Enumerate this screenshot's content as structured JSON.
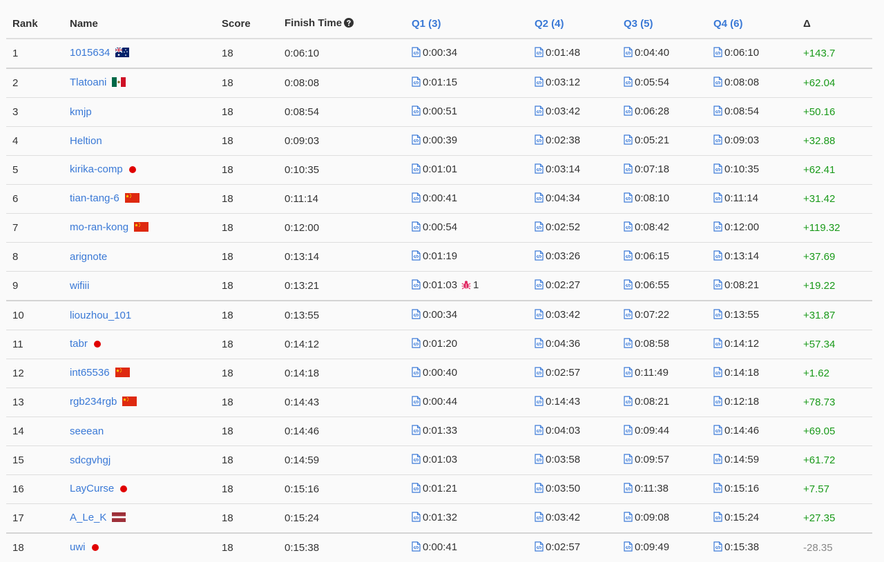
{
  "header": {
    "rank": "Rank",
    "name": "Name",
    "score": "Score",
    "finish_time": "Finish Time",
    "q1": "Q1 (3)",
    "q2": "Q2 (4)",
    "q3": "Q3 (5)",
    "q4": "Q4 (6)",
    "delta": "Δ"
  },
  "colors": {
    "link": "#3a79d6",
    "positive": "#1a9a1a",
    "negative": "#888888",
    "bug": "#e0245e"
  },
  "rows": [
    {
      "rank": "1",
      "name": "1015634",
      "flag": "au",
      "score": "18",
      "finish": "0:06:10",
      "q1": "0:00:34",
      "q2": "0:01:48",
      "q3": "0:04:40",
      "q4": "0:06:10",
      "delta": "+143.7"
    },
    {
      "rank": "2",
      "name": "Tlatoani",
      "flag": "mx",
      "score": "18",
      "finish": "0:08:08",
      "q1": "0:01:15",
      "q2": "0:03:12",
      "q3": "0:05:54",
      "q4": "0:08:08",
      "delta": "+62.04"
    },
    {
      "rank": "3",
      "name": "kmjp",
      "flag": "",
      "score": "18",
      "finish": "0:08:54",
      "q1": "0:00:51",
      "q2": "0:03:42",
      "q3": "0:06:28",
      "q4": "0:08:54",
      "delta": "+50.16"
    },
    {
      "rank": "4",
      "name": "Heltion",
      "flag": "",
      "score": "18",
      "finish": "0:09:03",
      "q1": "0:00:39",
      "q2": "0:02:38",
      "q3": "0:05:21",
      "q4": "0:09:03",
      "delta": "+32.88"
    },
    {
      "rank": "5",
      "name": "kirika-comp",
      "flag": "jp",
      "score": "18",
      "finish": "0:10:35",
      "q1": "0:01:01",
      "q2": "0:03:14",
      "q3": "0:07:18",
      "q4": "0:10:35",
      "delta": "+62.41"
    },
    {
      "rank": "6",
      "name": "tian-tang-6",
      "flag": "cn",
      "score": "18",
      "finish": "0:11:14",
      "q1": "0:00:41",
      "q2": "0:04:34",
      "q3": "0:08:10",
      "q4": "0:11:14",
      "delta": "+31.42"
    },
    {
      "rank": "7",
      "name": "mo-ran-kong",
      "flag": "cn",
      "score": "18",
      "finish": "0:12:00",
      "q1": "0:00:54",
      "q2": "0:02:52",
      "q3": "0:08:42",
      "q4": "0:12:00",
      "delta": "+119.32"
    },
    {
      "rank": "8",
      "name": "arignote",
      "flag": "",
      "score": "18",
      "finish": "0:13:14",
      "q1": "0:01:19",
      "q2": "0:03:26",
      "q3": "0:06:15",
      "q4": "0:13:14",
      "delta": "+37.69"
    },
    {
      "rank": "9",
      "name": "wifiii",
      "flag": "",
      "score": "18",
      "finish": "0:13:21",
      "q1": "0:01:03",
      "q1_bugs": "1",
      "q2": "0:02:27",
      "q3": "0:06:55",
      "q4": "0:08:21",
      "delta": "+19.22"
    },
    {
      "rank": "10",
      "name": "liouzhou_101",
      "flag": "",
      "score": "18",
      "finish": "0:13:55",
      "q1": "0:00:34",
      "q2": "0:03:42",
      "q3": "0:07:22",
      "q4": "0:13:55",
      "delta": "+31.87"
    },
    {
      "rank": "11",
      "name": "tabr",
      "flag": "jp",
      "score": "18",
      "finish": "0:14:12",
      "q1": "0:01:20",
      "q2": "0:04:36",
      "q3": "0:08:58",
      "q4": "0:14:12",
      "delta": "+57.34"
    },
    {
      "rank": "12",
      "name": "int65536",
      "flag": "cn",
      "score": "18",
      "finish": "0:14:18",
      "q1": "0:00:40",
      "q2": "0:02:57",
      "q3": "0:11:49",
      "q4": "0:14:18",
      "delta": "+1.62"
    },
    {
      "rank": "13",
      "name": "rgb234rgb",
      "flag": "cn",
      "score": "18",
      "finish": "0:14:43",
      "q1": "0:00:44",
      "q2": "0:14:43",
      "q3": "0:08:21",
      "q4": "0:12:18",
      "delta": "+78.73"
    },
    {
      "rank": "14",
      "name": "seeean",
      "flag": "",
      "score": "18",
      "finish": "0:14:46",
      "q1": "0:01:33",
      "q2": "0:04:03",
      "q3": "0:09:44",
      "q4": "0:14:46",
      "delta": "+69.05"
    },
    {
      "rank": "15",
      "name": "sdcgvhgj",
      "flag": "",
      "score": "18",
      "finish": "0:14:59",
      "q1": "0:01:03",
      "q2": "0:03:58",
      "q3": "0:09:57",
      "q4": "0:14:59",
      "delta": "+61.72"
    },
    {
      "rank": "16",
      "name": "LayCurse",
      "flag": "jp",
      "score": "18",
      "finish": "0:15:16",
      "q1": "0:01:21",
      "q2": "0:03:50",
      "q3": "0:11:38",
      "q4": "0:15:16",
      "delta": "+7.57"
    },
    {
      "rank": "17",
      "name": "A_Le_K",
      "flag": "lv",
      "score": "18",
      "finish": "0:15:24",
      "q1": "0:01:32",
      "q2": "0:03:42",
      "q3": "0:09:08",
      "q4": "0:15:24",
      "delta": "+27.35"
    },
    {
      "rank": "18",
      "name": "uwi",
      "flag": "jp",
      "score": "18",
      "finish": "0:15:38",
      "q1": "0:00:41",
      "q2": "0:02:57",
      "q3": "0:09:49",
      "q4": "0:15:38",
      "delta": "-28.35"
    }
  ]
}
